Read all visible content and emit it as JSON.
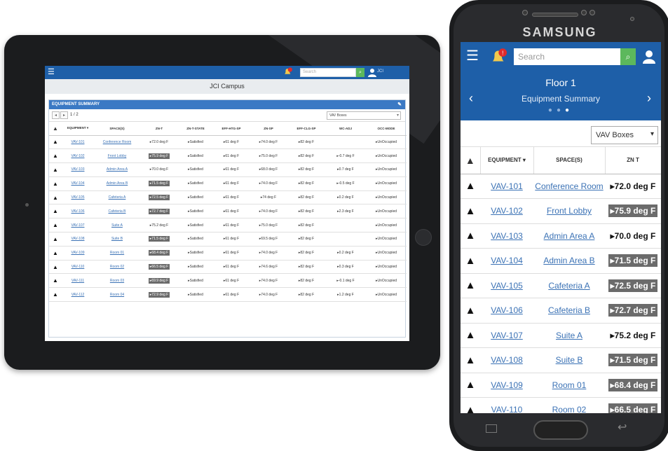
{
  "tablet": {
    "app_title": "JCI Campus",
    "search_placeholder": "Search",
    "username": "JCI",
    "panel_title": "EQUIPMENT SUMMARY",
    "page_text": "1 / 2",
    "equipment_type": "VAV Boxes",
    "columns": [
      "EQUIPMENT ▾",
      "SPACE(S)",
      "ZN-T",
      "ZN-T-STATE",
      "EFF-HTG-SP",
      "ZN-SP",
      "EFF-CLG-SP",
      "WC-ADJ",
      "OCC-MODE"
    ],
    "rows": [
      {
        "eq": "VAV-101",
        "sp": "Conference Room",
        "znt": "▸72.0 deg F",
        "hi": false,
        "st": "▸Satisfied",
        "htg": "▸61 deg F",
        "znsp": "▸74.0 deg F",
        "clg": "▸82 deg F",
        "adj": "",
        "occ": "▸UnOccupied"
      },
      {
        "eq": "VAV-102",
        "sp": "Front Lobby",
        "znt": "▸75.9 deg F",
        "hi": true,
        "st": "▸Satisfied",
        "htg": "▸61 deg F",
        "znsp": "▸75.0 deg F",
        "clg": "▸82 deg F",
        "adj": "▸-0.7 deg F",
        "occ": "▸UnOccupied"
      },
      {
        "eq": "VAV-103",
        "sp": "Admin Area A",
        "znt": "▸70.0 deg F",
        "hi": false,
        "st": "▸Satisfied",
        "htg": "▸61 deg F",
        "znsp": "▸68.0 deg F",
        "clg": "▸82 deg F",
        "adj": "▸0.7 deg F",
        "occ": "▸UnOccupied"
      },
      {
        "eq": "VAV-104",
        "sp": "Admin Area B",
        "znt": "▸71.5 deg F",
        "hi": true,
        "st": "▸Satisfied",
        "htg": "▸61 deg F",
        "znsp": "▸74.0 deg F",
        "clg": "▸82 deg F",
        "adj": "▸-0.5 deg F",
        "occ": "▸UnOccupied"
      },
      {
        "eq": "VAV-105",
        "sp": "Cafeteria A",
        "znt": "▸72.5 deg F",
        "hi": true,
        "st": "▸Satisfied",
        "htg": "▸61 deg F",
        "znsp": "▸74 deg F",
        "clg": "▸82 deg F",
        "adj": "▸0.2 deg F",
        "occ": "▸UnOccupied"
      },
      {
        "eq": "VAV-106",
        "sp": "Cafeteria B",
        "znt": "▸72.7 deg F",
        "hi": true,
        "st": "▸Satisfied",
        "htg": "▸61 deg F",
        "znsp": "▸74.0 deg F",
        "clg": "▸82 deg F",
        "adj": "▸2.3 deg F",
        "occ": "▸UnOccupied"
      },
      {
        "eq": "VAV-107",
        "sp": "Suite A",
        "znt": "▸75.2 deg F",
        "hi": false,
        "st": "▸Satisfied",
        "htg": "▸61 deg F",
        "znsp": "▸75.0 deg F",
        "clg": "▸82 deg F",
        "adj": "",
        "occ": "▸UnOccupied"
      },
      {
        "eq": "VAV-108",
        "sp": "Suite B",
        "znt": "▸71.5 deg F",
        "hi": true,
        "st": "▸Satisfied",
        "htg": "▸61 deg F",
        "znsp": "▸69.5 deg F",
        "clg": "▸82 deg F",
        "adj": "",
        "occ": "▸UnOccupied"
      },
      {
        "eq": "VAV-109",
        "sp": "Room 01",
        "znt": "▸68.4 deg F",
        "hi": true,
        "st": "▸Satisfied",
        "htg": "▸61 deg F",
        "znsp": "▸74.0 deg F",
        "clg": "▸82 deg F",
        "adj": "▸0.2 deg F",
        "occ": "▸UnOccupied"
      },
      {
        "eq": "VAV-110",
        "sp": "Room 02",
        "znt": "▸66.5 deg F",
        "hi": true,
        "st": "▸Satisfied",
        "htg": "▸61 deg F",
        "znsp": "▸74.6 deg F",
        "clg": "▸82 deg F",
        "adj": "▸0.3 deg F",
        "occ": "▸UnOccupied"
      },
      {
        "eq": "VAV-111",
        "sp": "Room 03",
        "znt": "▸69.9 deg F",
        "hi": true,
        "st": "▸Satisfied",
        "htg": "▸61 deg F",
        "znsp": "▸74.0 deg F",
        "clg": "▸82 deg F",
        "adj": "▸-0.1 deg F",
        "occ": "▸UnOccupied"
      },
      {
        "eq": "VAV-112",
        "sp": "Room 04",
        "znt": "▸72.9 deg F",
        "hi": true,
        "st": "▸Satisfied",
        "htg": "▸61 deg F",
        "znsp": "▸74.0 deg F",
        "clg": "▸82 deg F",
        "adj": "▸1.2 deg F",
        "occ": "▸UnOccupied"
      }
    ]
  },
  "phone": {
    "brand": "SAMSUNG",
    "search_placeholder": "Search",
    "floor_title": "Floor 1",
    "subtitle": "Equipment Summary",
    "equipment_type": "VAV Boxes",
    "columns": [
      "EQUIPMENT ▾",
      "SPACE(S)",
      "ZN T"
    ],
    "rows": [
      {
        "eq": "VAV-101",
        "sp": "Conference Room",
        "znt": "▸72.0 deg F",
        "hi": false
      },
      {
        "eq": "VAV-102",
        "sp": "Front Lobby",
        "znt": "▸75.9 deg F",
        "hi": true
      },
      {
        "eq": "VAV-103",
        "sp": "Admin Area A",
        "znt": "▸70.0 deg F",
        "hi": false
      },
      {
        "eq": "VAV-104",
        "sp": "Admin Area B",
        "znt": "▸71.5 deg F",
        "hi": true
      },
      {
        "eq": "VAV-105",
        "sp": "Cafeteria A",
        "znt": "▸72.5 deg F",
        "hi": true
      },
      {
        "eq": "VAV-106",
        "sp": "Cafeteria B",
        "znt": "▸72.7 deg F",
        "hi": true
      },
      {
        "eq": "VAV-107",
        "sp": "Suite A",
        "znt": "▸75.2 deg F",
        "hi": false
      },
      {
        "eq": "VAV-108",
        "sp": "Suite B",
        "znt": "▸71.5 deg F",
        "hi": true
      },
      {
        "eq": "VAV-109",
        "sp": "Room 01",
        "znt": "▸68.4 deg F",
        "hi": true
      },
      {
        "eq": "VAV-110",
        "sp": "Room 02",
        "znt": "▸66.5 deg F",
        "hi": true
      }
    ]
  },
  "colors": {
    "nav": "#1e5fa8",
    "accent_green": "#5cb85c",
    "alert_red": "#e02b2b",
    "highlight_gray": "#6b6b6b"
  },
  "icons": [
    "menu-icon",
    "bell-icon",
    "search-icon",
    "user-icon",
    "alarm-triangle-icon",
    "pencil-icon",
    "chevron-left-icon",
    "chevron-right-icon"
  ]
}
